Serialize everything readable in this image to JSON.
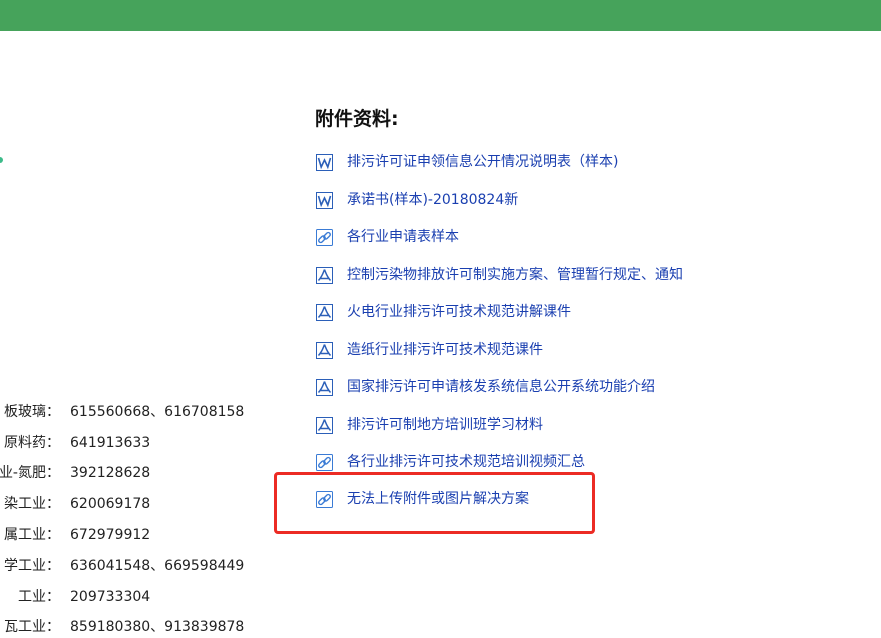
{
  "attachments": {
    "heading": "附件资料:",
    "items": [
      {
        "label": "排污许可证申领信息公开情况说明表（样本)",
        "icon": "word-doc-icon"
      },
      {
        "label": "承诺书(样本)-20180824新",
        "icon": "word-doc-icon"
      },
      {
        "label": "各行业申请表样本",
        "icon": "link-icon"
      },
      {
        "label": "控制污染物排放许可制实施方案、管理暂行规定、通知",
        "icon": "pdf-icon"
      },
      {
        "label": "火电行业排污许可技术规范讲解课件",
        "icon": "pdf-icon"
      },
      {
        "label": "造纸行业排污许可技术规范课件",
        "icon": "pdf-icon"
      },
      {
        "label": "国家排污许可申请核发系统信息公开系统功能介绍",
        "icon": "pdf-icon"
      },
      {
        "label": "排污许可制地方培训班学习材料",
        "icon": "pdf-icon"
      },
      {
        "label": "各行业排污许可技术规范培训视频汇总",
        "icon": "link-icon"
      },
      {
        "label": "无法上传附件或图片解决方案",
        "icon": "link-icon"
      }
    ]
  },
  "contacts": {
    "rows": [
      {
        "industry": "板玻璃：",
        "numbers": "615560668、616708158"
      },
      {
        "industry": "原料药：",
        "numbers": "641913633"
      },
      {
        "industry": "业-氮肥：",
        "numbers": "392128628"
      },
      {
        "industry": "染工业：",
        "numbers": "620069178"
      },
      {
        "industry": "属工业：",
        "numbers": "672979912"
      },
      {
        "industry": "学工业：",
        "numbers": "636041548、669598449"
      },
      {
        "industry": "工业：",
        "numbers": "209733304"
      },
      {
        "industry": "瓦工业：",
        "numbers": "859180380、913839878"
      }
    ]
  },
  "colors": {
    "header_green": "#46a35b",
    "link_blue": "#1a3fb0",
    "highlight_red": "#ec2b24"
  }
}
